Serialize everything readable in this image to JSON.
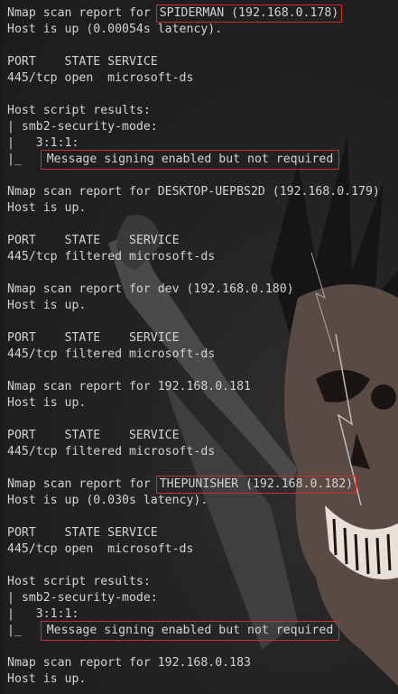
{
  "terminal": {
    "lines": [
      {
        "pre": "Nmap scan report for ",
        "hl": "SPIDERMAN (192.168.0.178)",
        "post": ""
      },
      {
        "text": "Host is up (0.00054s latency)."
      },
      {
        "text": ""
      },
      {
        "text": "PORT    STATE SERVICE"
      },
      {
        "text": "445/tcp open  microsoft-ds"
      },
      {
        "text": ""
      },
      {
        "text": "Host script results:"
      },
      {
        "text": "| smb2-security-mode:"
      },
      {
        "text": "|   3:1:1:"
      },
      {
        "pre": "|_   ",
        "hl": "Message signing enabled but not required",
        "post": ""
      },
      {
        "text": ""
      },
      {
        "text": "Nmap scan report for DESKTOP-UEPBS2D (192.168.0.179)"
      },
      {
        "text": "Host is up."
      },
      {
        "text": ""
      },
      {
        "text": "PORT    STATE    SERVICE"
      },
      {
        "text": "445/tcp filtered microsoft-ds"
      },
      {
        "text": ""
      },
      {
        "text": "Nmap scan report for dev (192.168.0.180)"
      },
      {
        "text": "Host is up."
      },
      {
        "text": ""
      },
      {
        "text": "PORT    STATE    SERVICE"
      },
      {
        "text": "445/tcp filtered microsoft-ds"
      },
      {
        "text": ""
      },
      {
        "text": "Nmap scan report for 192.168.0.181"
      },
      {
        "text": "Host is up."
      },
      {
        "text": ""
      },
      {
        "text": "PORT    STATE    SERVICE"
      },
      {
        "text": "445/tcp filtered microsoft-ds"
      },
      {
        "text": ""
      },
      {
        "pre": "Nmap scan report for ",
        "hl": "THEPUNISHER (192.168.0.182)",
        "post": ""
      },
      {
        "text": "Host is up (0.030s latency)."
      },
      {
        "text": ""
      },
      {
        "text": "PORT    STATE SERVICE"
      },
      {
        "text": "445/tcp open  microsoft-ds"
      },
      {
        "text": ""
      },
      {
        "text": "Host script results:"
      },
      {
        "text": "| smb2-security-mode:"
      },
      {
        "text": "|   3:1:1:"
      },
      {
        "pre": "|_   ",
        "hl": "Message signing enabled but not required",
        "post": ""
      },
      {
        "text": ""
      },
      {
        "text": "Nmap scan report for 192.168.0.183"
      },
      {
        "text": "Host is up."
      }
    ]
  },
  "colors": {
    "text": "#d3d3d3",
    "highlight_border": "#d12c2c",
    "background": "#202020"
  },
  "wallpaper": {
    "description_icon": "punisher-skull-art"
  }
}
